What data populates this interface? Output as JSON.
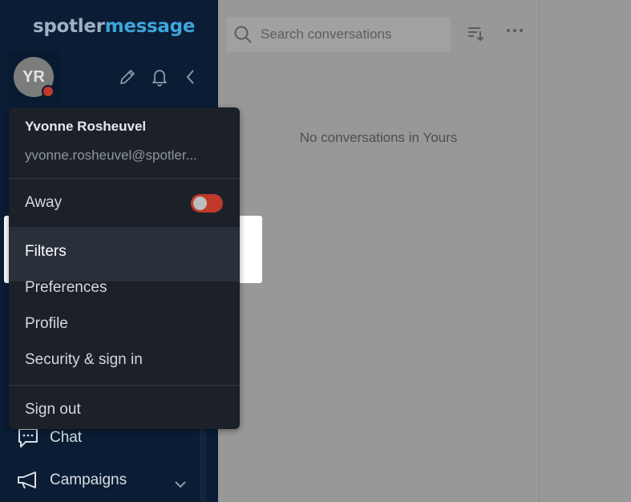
{
  "brand": {
    "part1": "spotler",
    "part2": "message"
  },
  "user": {
    "initials": "YR",
    "name": "Yvonne Rosheuvel",
    "email": "yvonne.rosheuvel@spotler..."
  },
  "header_icons": [
    "pencil-icon",
    "bell-icon",
    "collapse-chevron-icon"
  ],
  "menu": {
    "away_label": "Away",
    "away_enabled": false,
    "items": [
      "Filters",
      "Preferences",
      "Profile",
      "Security & sign in"
    ],
    "sign_out": "Sign out"
  },
  "nav": {
    "chat": "Chat",
    "campaigns": "Campaigns"
  },
  "search": {
    "placeholder": "Search conversations"
  },
  "main": {
    "empty_message": "No conversations in Yours"
  },
  "colors": {
    "sidebar_bg": "#0a1d35",
    "menu_bg": "#1c2028",
    "status_red": "#c0392b",
    "brand_blue": "#3ea6da"
  }
}
